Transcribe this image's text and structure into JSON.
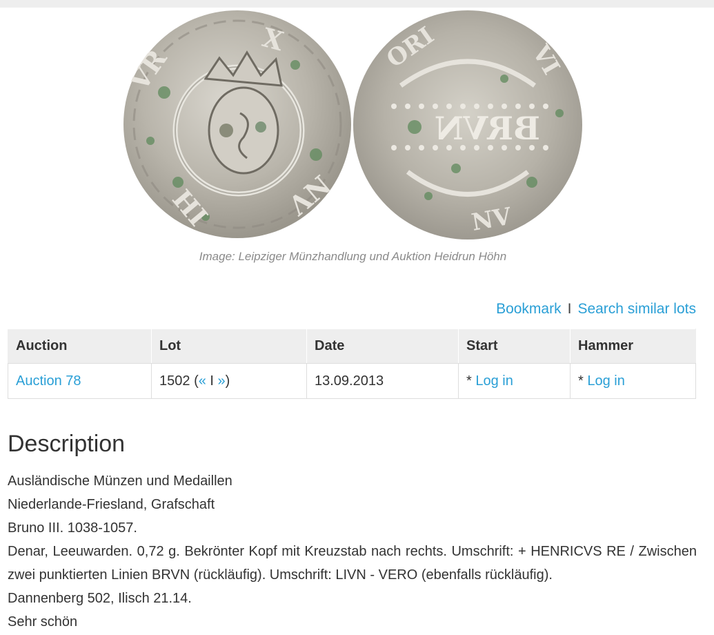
{
  "image_credit": "Image: Leipziger Münzhandlung und Auktion Heidrun Höhn",
  "actions": {
    "bookmark": "Bookmark",
    "separator": "I",
    "search_similar": "Search similar lots"
  },
  "table": {
    "headers": [
      "Auction",
      "Lot",
      "Date",
      "Start",
      "Hammer"
    ],
    "row": {
      "auction": "Auction 78",
      "lot_number": "1502",
      "lot_open": "(",
      "lot_prev": "«",
      "lot_sep": "I",
      "lot_next": "»",
      "lot_close": ")",
      "date": "13.09.2013",
      "start_prefix": "*",
      "start_login": "Log in",
      "hammer_prefix": "*",
      "hammer_login": "Log in"
    }
  },
  "description": {
    "title": "Description",
    "lines": [
      "Ausländische Münzen und Medaillen",
      "Niederlande-Friesland, Grafschaft",
      "Bruno III. 1038-1057.",
      "Denar, Leeuwarden. 0,72 g. Bekrönter Kopf mit Kreuzstab nach rechts. Umschrift: + HENRICVS RE / Zwischen zwei punktierten Linien BRVN (rückläufig). Umschrift: LIVN - VERO (ebenfalls rückläufig).",
      "Dannenberg 502, Ilisch 21.14.",
      "Sehr schön"
    ]
  },
  "colors": {
    "link": "#2a9fd6",
    "text": "#333333",
    "caption": "#8a8a8a",
    "header_bg": "#eeeeee"
  }
}
